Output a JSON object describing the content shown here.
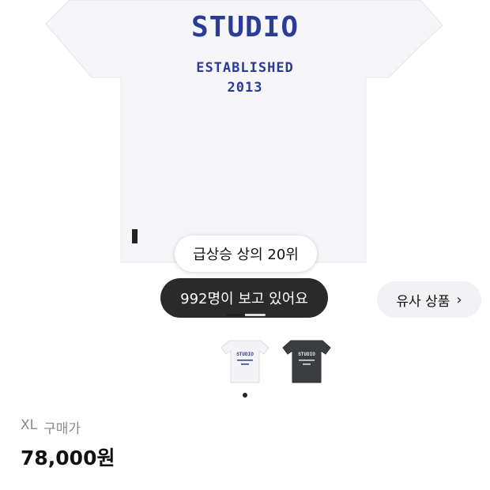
{
  "product_image": {
    "print_title": "STUDIO",
    "print_established": "ESTABLISHED",
    "print_year": "2013"
  },
  "badges": {
    "rank": "급상승 상의 20위",
    "viewers": "992명이 보고 있어요"
  },
  "similar_button": {
    "label": "유사 상품",
    "icon": "chevron-right-icon"
  },
  "image_indicator": {
    "current": 1,
    "total": 2
  },
  "thumbnails": [
    {
      "color": "white",
      "print_title": "STUDIO"
    },
    {
      "color": "charcoal",
      "print_title": "STUDIO"
    }
  ],
  "purchase": {
    "size": "XL",
    "price_label": "구매가",
    "price": "78,000원"
  },
  "colors": {
    "print_blue": "#2b3b98",
    "dark_pill": "#2a2a2a",
    "light_pill": "#f2f2f4",
    "shirt_dark": "#3a3d40"
  }
}
